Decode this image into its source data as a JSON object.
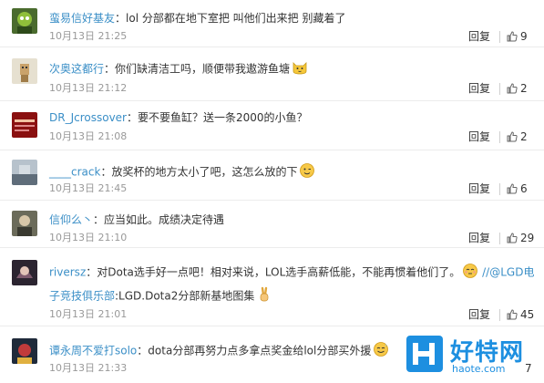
{
  "ui": {
    "reply_label": "回复"
  },
  "comments": [
    {
      "user": "蛮易信好基友",
      "text": "lol 分部都在地下室把 叫他们出来把 别藏着了",
      "time": "10月13日 21:25",
      "likes": "9"
    },
    {
      "user": "次奥这都行",
      "text": "你们缺清洁工吗，顺便带我遨游鱼塘",
      "time": "10月13日 21:12",
      "likes": "2"
    },
    {
      "user": "DR_Jcrossover",
      "text": "要不要鱼缸？送一条2000的小鱼？",
      "time": "10月13日 21:08",
      "likes": "2"
    },
    {
      "user": "____crack",
      "text": "放奖杯的地方太小了吧，这怎么放的下",
      "time": "10月13日 21:45",
      "likes": "6"
    },
    {
      "user": "信仰么丶",
      "text": "应当如此。成绩决定待遇",
      "time": "10月13日 21:10",
      "likes": "29"
    },
    {
      "user": "riversz",
      "text": "对Dota选手好一点吧！相对来说，LOL选手高薪低能，不能再惯着他们了。",
      "mention": "//@LGD电",
      "mention2": "子竞技俱乐部",
      "text2": ":LGD.Dota2分部新基地图集",
      "time": "10月13日 21:01",
      "likes": "45"
    },
    {
      "user": "谭永周不爱打solo",
      "text": "dota分部再努力点多拿点奖金给lol分部买外援",
      "time": "10月13日 21:33",
      "likes": "7"
    }
  ],
  "watermark": {
    "name": "好特网",
    "url": "haote.com"
  }
}
